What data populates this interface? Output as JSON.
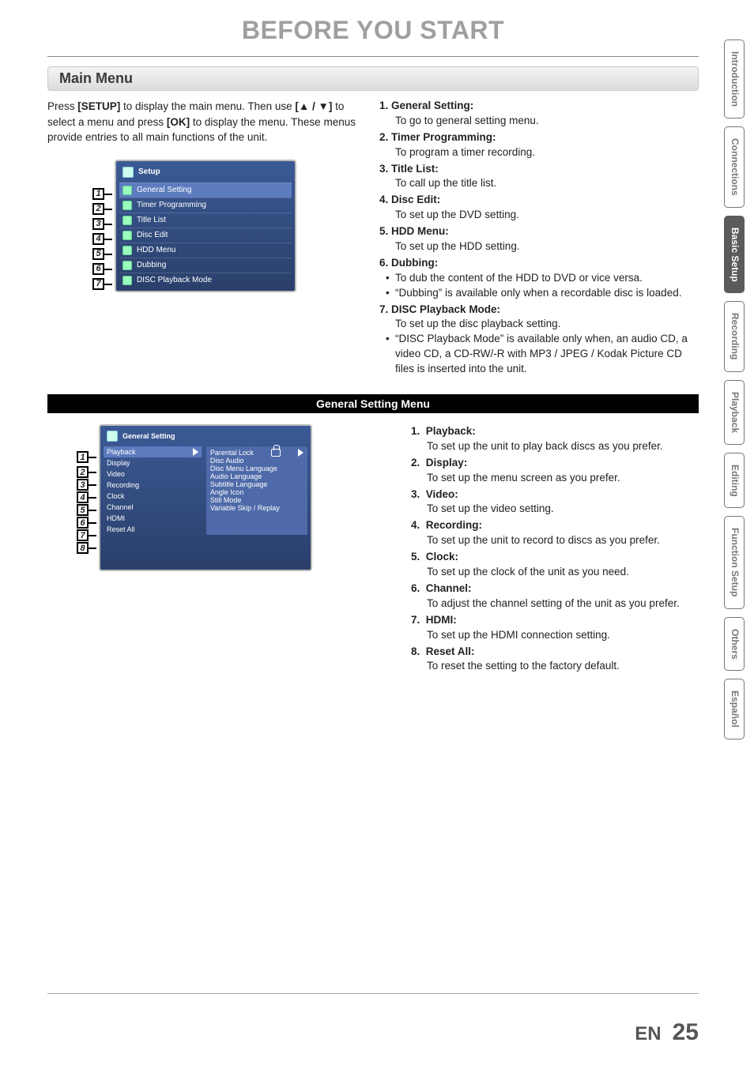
{
  "page_title": "BEFORE YOU START",
  "section_main": "Main Menu",
  "intro_parts": {
    "p1a": "Press ",
    "p1b": "[SETUP]",
    "p1c": " to display the main menu. Then use ",
    "p2a": "[",
    "arrows": "▲ / ▼",
    "p2b": "]",
    "p2c": " to select a menu and press ",
    "p2d": "[OK]",
    "p2e": " to display the menu. These menus provide entries to all main functions of the unit."
  },
  "setup_osd": {
    "title": "Setup",
    "rows": [
      "General Setting",
      "Timer Programming",
      "Title List",
      "Disc Edit",
      "HDD Menu",
      "Dubbing",
      "DISC Playback Mode"
    ]
  },
  "main_list": [
    {
      "n": "1.",
      "label": "General Setting:",
      "desc": "To go to general setting menu."
    },
    {
      "n": "2.",
      "label": "Timer Programming:",
      "desc": "To program a timer recording."
    },
    {
      "n": "3.",
      "label": "Title List:",
      "desc": "To call up the title list."
    },
    {
      "n": "4.",
      "label": "Disc Edit:",
      "desc": "To set up the DVD setting."
    },
    {
      "n": "5.",
      "label": "HDD Menu:",
      "desc": "To set up the HDD setting."
    },
    {
      "n": "6.",
      "label": "Dubbing:",
      "bullets": [
        "To dub the content of the HDD to DVD or vice versa.",
        "“Dubbing” is available only when a recordable disc is loaded."
      ]
    },
    {
      "n": "7.",
      "label": "DISC Playback Mode:",
      "desc": "To set up the disc playback setting.",
      "bullets": [
        "“DISC Playback Mode” is available only when, an audio CD, a video CD, a CD-RW/-R with MP3 / JPEG / Kodak Picture CD files is inserted into the unit."
      ]
    }
  ],
  "sub_header": "General Setting Menu",
  "gs_osd": {
    "title": "General Setting",
    "left": [
      "Playback",
      "Display",
      "Video",
      "Recording",
      "Clock",
      "Channel",
      "HDMI",
      "Reset All"
    ],
    "right": [
      "Parental Lock",
      "Disc Audio",
      "Disc Menu Language",
      "Audio Language",
      "Subtitle Language",
      "Angle Icon",
      "Still Mode",
      "Variable Skip / Replay"
    ]
  },
  "gs_list": [
    {
      "n": "1.",
      "label": "Playback:",
      "desc": "To set up the unit to play back discs as you prefer."
    },
    {
      "n": "2.",
      "label": "Display:",
      "desc": "To set up the menu screen as you prefer."
    },
    {
      "n": "3.",
      "label": "Video:",
      "desc": "To set up the video setting."
    },
    {
      "n": "4.",
      "label": "Recording:",
      "desc": "To set up the unit to record to discs as you prefer."
    },
    {
      "n": "5.",
      "label": "Clock:",
      "desc": "To set up the clock of the unit as you need."
    },
    {
      "n": "6.",
      "label": "Channel:",
      "desc": "To adjust the channel setting of the unit as you prefer."
    },
    {
      "n": "7.",
      "label": "HDMI:",
      "desc": "To set up the HDMI connection setting."
    },
    {
      "n": "8.",
      "label": "Reset All:",
      "desc": "To reset the setting to the factory default."
    }
  ],
  "tabs": [
    "Introduction",
    "Connections",
    "Basic Setup",
    "Recording",
    "Playback",
    "Editing",
    "Function Setup",
    "Others",
    "Español"
  ],
  "active_tab": "Basic Setup",
  "footer": {
    "lang": "EN",
    "page": "25"
  }
}
